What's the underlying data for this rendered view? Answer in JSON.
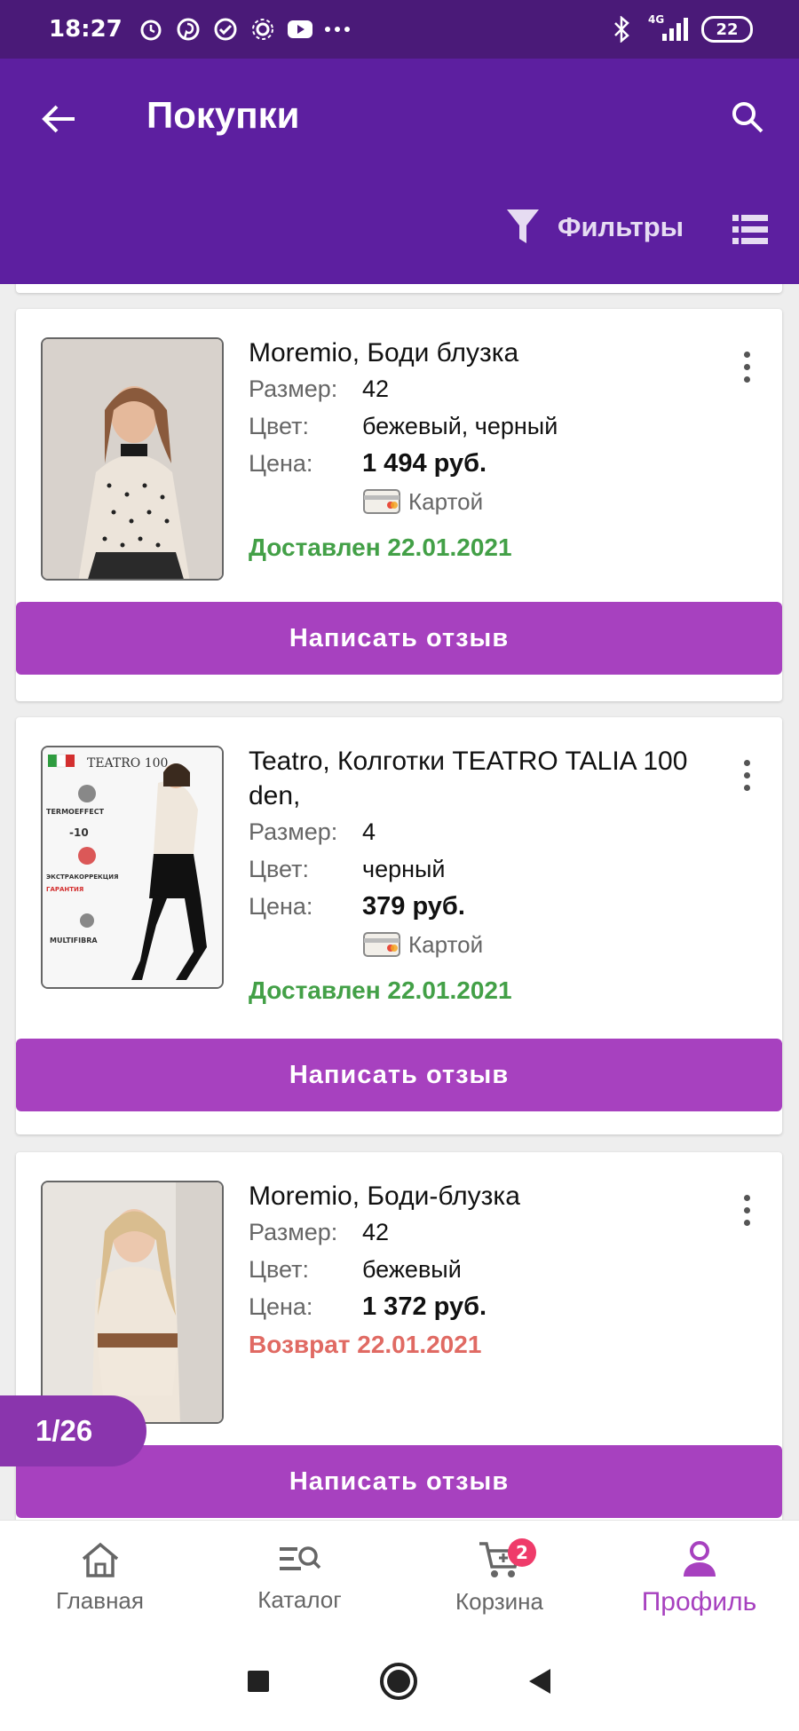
{
  "status_bar": {
    "time": "18:27",
    "network": "4G",
    "battery": "22"
  },
  "header": {
    "title": "Покупки",
    "filters_label": "Фильтры"
  },
  "labels": {
    "size": "Размер:",
    "color": "Цвет:",
    "price": "Цена:"
  },
  "orders": [
    {
      "title": "Moremio, Боди блузка",
      "size": "42",
      "color": "бежевый, черный",
      "price": "1 494 руб.",
      "payment": "Картой",
      "status": "Доставлен 22.01.2021",
      "button": "Написать отзыв"
    },
    {
      "title": "Teatro, Колготки TEATRO TALIA 100 den,",
      "size": "4",
      "color": "черный",
      "price": "379 руб.",
      "payment": "Картой",
      "status": "Доставлен 22.01.2021",
      "button": "Написать отзыв"
    },
    {
      "title": "Moremio, Боди-блузка",
      "size": "42",
      "color": "бежевый",
      "price": "1 372 руб.",
      "status": "Возврат 22.01.2021",
      "button": "Написать отзыв"
    }
  ],
  "pager": "1/26",
  "bottom_nav": {
    "items": [
      {
        "label": "Главная",
        "icon": "home-icon"
      },
      {
        "label": "Каталог",
        "icon": "catalog-search-icon"
      },
      {
        "label": "Корзина",
        "icon": "cart-icon",
        "badge": "2"
      },
      {
        "label": "Профиль",
        "icon": "profile-icon",
        "active": true
      }
    ]
  },
  "colors": {
    "app_bar": "#5d1fa0",
    "accent": "#a741bf",
    "delivered": "#43a047",
    "returned": "#e06a63"
  }
}
